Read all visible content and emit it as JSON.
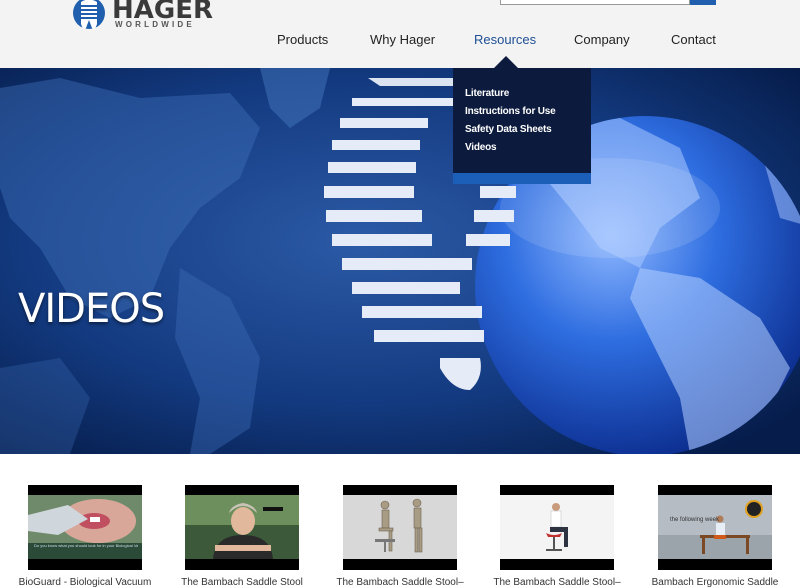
{
  "header": {
    "logo": {
      "word": "HAGER",
      "sub": "WORLDWIDE",
      "icon": "hager-logo-icon"
    },
    "search": {
      "placeholder": ""
    },
    "nav": [
      {
        "label": "Products"
      },
      {
        "label": "Why Hager"
      },
      {
        "label": "Resources",
        "active": true
      },
      {
        "label": "Company"
      },
      {
        "label": "Contact"
      }
    ]
  },
  "dropdown": {
    "items": [
      {
        "label": "Literature"
      },
      {
        "label": "Instructions for Use"
      },
      {
        "label": "Safety Data Sheets"
      },
      {
        "label": "Videos"
      }
    ]
  },
  "hero": {
    "title": "VIDEOS"
  },
  "videos": [
    {
      "title": "BioGuard - Biological Vacuum",
      "caption": "Do you know what you should look for in your Biological Vacuum?"
    },
    {
      "title": "The Bambach Saddle Stool"
    },
    {
      "title": "The Bambach Saddle Stool–"
    },
    {
      "title": "The Bambach Saddle Stool–"
    },
    {
      "title": "Bambach Ergonomic Saddle",
      "caption": "the following week"
    }
  ],
  "colors": {
    "accent": "#1e4f94",
    "dropdown_bg": "#0c1b3d",
    "dropdown_bar": "#1b5fb8",
    "hero_bg": "#0a2a63"
  }
}
